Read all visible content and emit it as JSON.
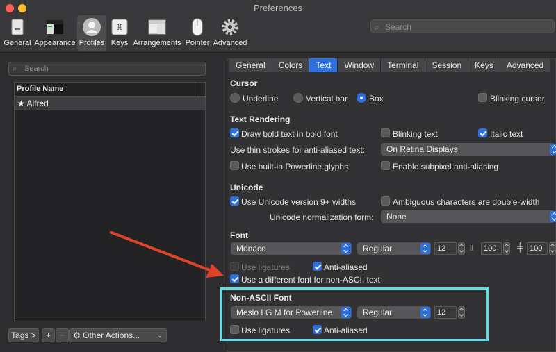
{
  "window": {
    "title": "Preferences"
  },
  "colors": {
    "accent": "#2f6fde",
    "highlight": "#5ce0e6",
    "annotation_arrow": "#e0432c",
    "close": "#fd5f57",
    "minimize": "#febc2e"
  },
  "toolbar": {
    "items": [
      {
        "label": "General",
        "icon": "general-icon"
      },
      {
        "label": "Appearance",
        "icon": "appearance-icon"
      },
      {
        "label": "Profiles",
        "icon": "profiles-icon"
      },
      {
        "label": "Keys",
        "icon": "keys-icon"
      },
      {
        "label": "Arrangements",
        "icon": "arrangements-icon"
      },
      {
        "label": "Pointer",
        "icon": "pointer-icon"
      },
      {
        "label": "Advanced",
        "icon": "gear-icon"
      }
    ],
    "search_placeholder": "Search"
  },
  "profiles": {
    "search_placeholder": "Search",
    "column_header": "Profile Name",
    "items": [
      {
        "name": "Alfred",
        "star": "★"
      }
    ],
    "footer": {
      "tags": "Tags >",
      "add": "+",
      "remove": "−",
      "other_actions": "Other Actions..."
    }
  },
  "tabs": [
    "General",
    "Colors",
    "Text",
    "Window",
    "Terminal",
    "Session",
    "Keys",
    "Advanced"
  ],
  "selected_tab": "Text",
  "cursor": {
    "heading": "Cursor",
    "underline": "Underline",
    "vertical_bar": "Vertical bar",
    "box": "Box",
    "selected": "Box",
    "blinking": "Blinking cursor"
  },
  "text_rendering": {
    "heading": "Text Rendering",
    "bold": "Draw bold text in bold font",
    "blinking_text": "Blinking text",
    "italic": "Italic text",
    "thin_strokes_label": "Use thin strokes for anti-aliased text:",
    "thin_strokes_value": "On Retina Displays",
    "powerline": "Use built-in Powerline glyphs",
    "subpixel": "Enable subpixel anti-aliasing"
  },
  "unicode": {
    "heading": "Unicode",
    "version9": "Use Unicode version 9+ widths",
    "ambiguous": "Ambiguous characters are double-width",
    "normalization_label": "Unicode normalization form:",
    "normalization_value": "None"
  },
  "font": {
    "heading": "Font",
    "family": "Monaco",
    "style": "Regular",
    "size": "12",
    "h_spacing": "100",
    "v_spacing": "100",
    "ligatures": "Use ligatures",
    "antialiased": "Anti-aliased",
    "non_ascii_toggle": "Use a different font for non-ASCII text"
  },
  "non_ascii_font": {
    "heading": "Non-ASCII Font",
    "family": "Meslo LG M for Powerline",
    "style": "Regular",
    "size": "12",
    "ligatures": "Use ligatures",
    "antialiased": "Anti-aliased"
  }
}
